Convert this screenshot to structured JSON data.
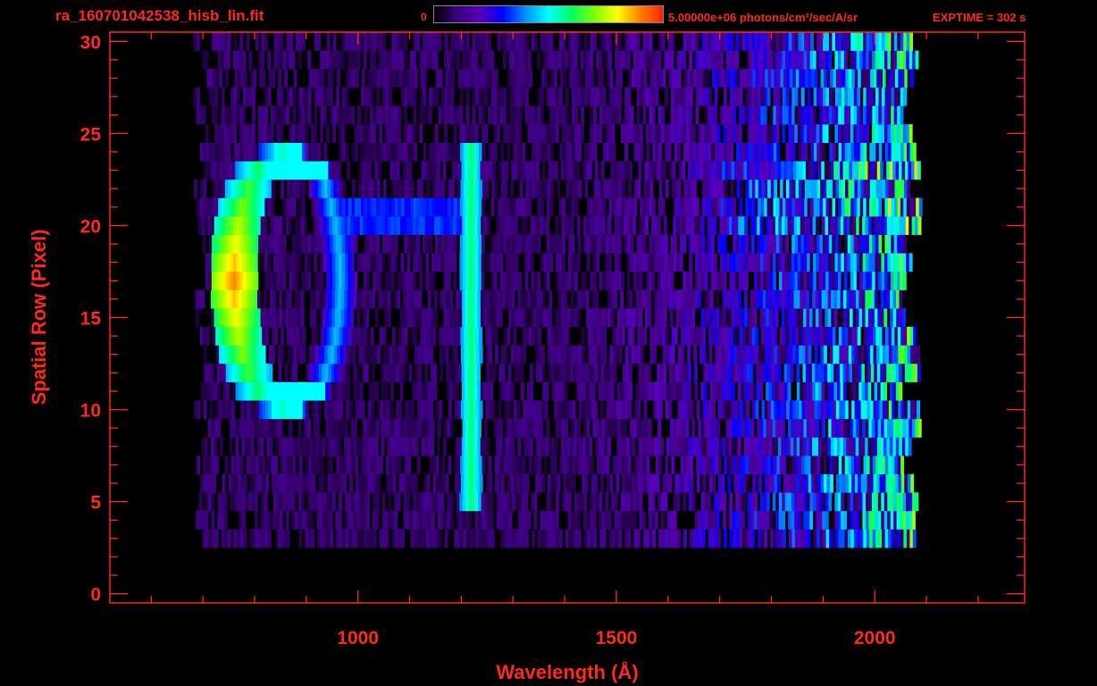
{
  "header": {
    "filename": "ra_160701042538_hisb_lin.fit",
    "colorbar_min_label": "0",
    "colorbar_max_label": "5.00000e+06 photons/cm²/sec/A/sr",
    "exptime_label": "EXPTIME = 302 s"
  },
  "colors": {
    "axis": "#ff2a1a",
    "background": "#000000"
  },
  "colormap": [
    "#000000",
    "#3a0078",
    "#5800b8",
    "#0000ff",
    "#0090ff",
    "#00ffff",
    "#00ff60",
    "#80ff00",
    "#ffff00",
    "#ff8000",
    "#ff2000"
  ],
  "chart_data": {
    "type": "heatmap",
    "xlabel": "Wavelength (Å)",
    "ylabel": "Spatial Row (Pixel)",
    "xlim": [
      520,
      2290
    ],
    "ylim": [
      -0.5,
      30.5
    ],
    "x_ticks": [
      1000,
      1500,
      2000
    ],
    "y_ticks": [
      0,
      5,
      10,
      15,
      20,
      25,
      30
    ],
    "value_range": [
      0,
      5000000
    ],
    "value_units": "photons/cm²/sec/A/sr",
    "data_extent_x": [
      690,
      2090
    ],
    "data_rows": [
      3,
      30
    ],
    "features": [
      {
        "type": "ring",
        "center_wavelength": 860,
        "rows": [
          10,
          24
        ],
        "peak_intensity_fraction": 0.9
      },
      {
        "type": "line",
        "wavelength": 1216,
        "rows": [
          5,
          24
        ],
        "peak_intensity_fraction": 0.6
      },
      {
        "type": "continuum",
        "wavelengths": [
          1700,
          2070
        ],
        "intensity_fraction": [
          0.15,
          0.55
        ]
      }
    ]
  }
}
